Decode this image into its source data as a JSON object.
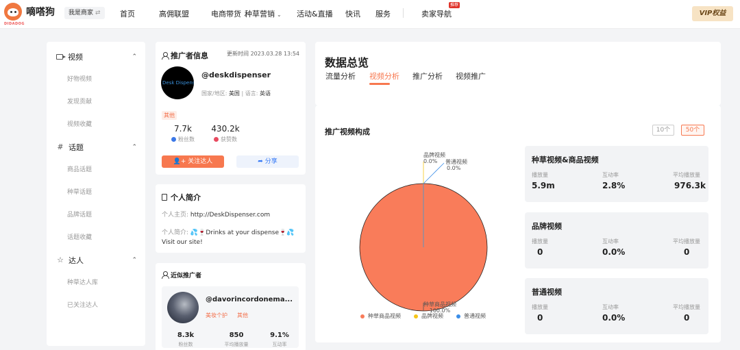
{
  "topnav": {
    "logo_text": "嘀嗒狗",
    "logo_sub": "DIDADOG",
    "merchant_label": "我是商家",
    "merchant_swap": "⇄",
    "items": [
      "首页",
      "高佣联盟",
      "电商带货",
      "种草营销",
      "活动&直播",
      "快讯",
      "服务",
      "卖家导航"
    ],
    "hot_badge": "推荐",
    "vip_label": "VIP权益"
  },
  "sidebar": {
    "groups": [
      {
        "label": "视频",
        "items": [
          "好物视频",
          "发现贡献",
          "视频收藏"
        ]
      },
      {
        "label": "话题",
        "items": [
          "商品话题",
          "种草话题",
          "品牌话题",
          "话题收藏"
        ]
      },
      {
        "label": "达人",
        "items": [
          "种草达人库",
          "已关注达人"
        ]
      }
    ]
  },
  "promoter": {
    "title": "推广者信息",
    "updated_label": "更新时间",
    "updated_value": "2023.03.28 13:54",
    "avatar_text": "Desk Dispenser",
    "handle": "@deskdispenser",
    "region_label": "国家/地区:",
    "region_value": "美国",
    "language_label": "| 语言:",
    "language_value": "英语",
    "tag": "其他",
    "fans_value": "7.7k",
    "fans_label": "粉丝数",
    "likes_value": "430.2k",
    "likes_label": "获赞数",
    "follow_label": "关注达人",
    "share_label": "分享"
  },
  "intro": {
    "title": "个人简介",
    "homepage_label": "个人主页:",
    "homepage_value": "http://DeskDispenser.com",
    "bio_label": "个人简介:",
    "bio_value": "💦🍷Drinks at your dispense🍷💦 Visit our site!"
  },
  "recent": {
    "title": "近似推广者",
    "handle": "@davorincordonema...",
    "tag1": "美妆个护",
    "tag2": "其他",
    "fans_value": "8.3k",
    "fans_label": "粉丝数",
    "plays_value": "850",
    "plays_label": "平均播放量",
    "rate_value": "9.1%",
    "rate_label": "互动率"
  },
  "overview": {
    "title": "数据总览",
    "tabs": [
      "流量分析",
      "视频分析",
      "推广分析",
      "视频推广"
    ],
    "active_tab": 1
  },
  "composition": {
    "title": "推广视频构成",
    "count_options": [
      "10个",
      "50个"
    ],
    "active_count": 1
  },
  "chart_data": {
    "type": "pie",
    "title": "推广视频构成",
    "slices": [
      {
        "label": "种草商品视频",
        "value": 100.0,
        "display": "100.0%",
        "color": "#f97c5a"
      },
      {
        "label": "品牌视频",
        "value": 0.0,
        "display": "0.0%",
        "color": "#f5c518"
      },
      {
        "label": "普通视频",
        "value": 0.0,
        "display": "0.0%",
        "color": "#3b8ee8"
      }
    ],
    "legend_position": "bottom"
  },
  "metrics": [
    {
      "title": "种草视频&商品视频",
      "plays_label": "播放量",
      "plays": "5.9m",
      "rate_label": "互动率",
      "rate": "2.8%",
      "avg_label": "平均播放量",
      "avg": "976.3k"
    },
    {
      "title": "品牌视频",
      "plays_label": "播放量",
      "plays": "0",
      "rate_label": "互动率",
      "rate": "0.0%",
      "avg_label": "平均播放量",
      "avg": "0"
    },
    {
      "title": "普通视频",
      "plays_label": "播放量",
      "plays": "0",
      "rate_label": "互动率",
      "rate": "0.0%",
      "avg_label": "平均播放量",
      "avg": "0"
    }
  ]
}
